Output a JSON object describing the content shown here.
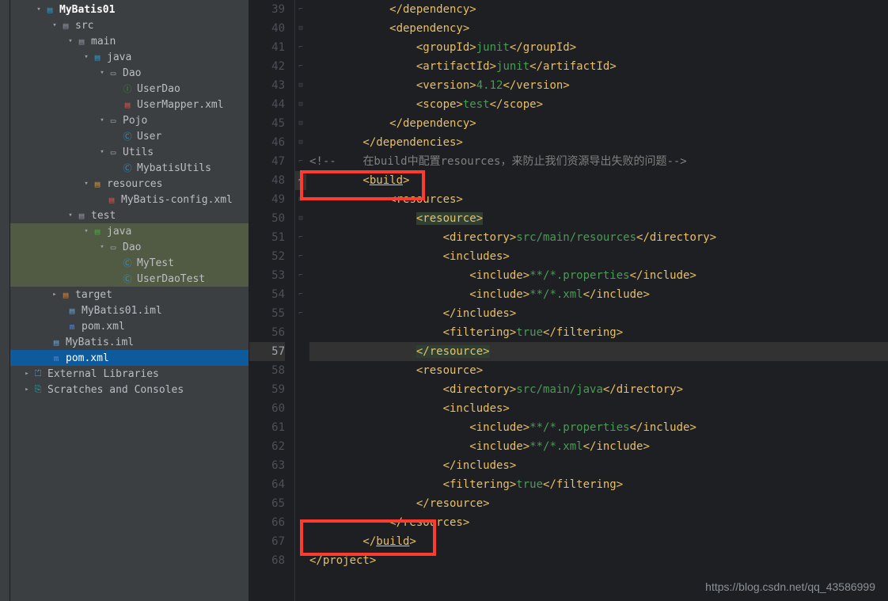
{
  "tree": {
    "MyBatis01": "MyBatis01",
    "src": "src",
    "main": "main",
    "java": "java",
    "Dao": "Dao",
    "UserDao": "UserDao",
    "UserMapper_xml": "UserMapper.xml",
    "Pojo": "Pojo",
    "User": "User",
    "Utils": "Utils",
    "MybatisUtils": "MybatisUtils",
    "resources": "resources",
    "MyBatis_config_xml": "MyBatis-config.xml",
    "test": "test",
    "java2": "java",
    "Dao2": "Dao",
    "MyTest": "MyTest",
    "UserDaoTest": "UserDaoTest",
    "target": "target",
    "MyBatis01_iml": "MyBatis01.iml",
    "pom_xml": "pom.xml",
    "MyBatis_iml": "MyBatis.iml",
    "root_pom_xml": "pom.xml",
    "External_Libraries": "External Libraries",
    "Scratches": "Scratches and Consoles"
  },
  "code": {
    "l39": "            </dependency>",
    "l40": "            <dependency>",
    "l41_a": "                <groupId>",
    "l41_v": "junit",
    "l41_b": "</groupId>",
    "l42_a": "                <artifactId>",
    "l42_v": "junit",
    "l42_b": "</artifactId>",
    "l43_a": "                <version>",
    "l43_v": "4.12",
    "l43_b": "</version>",
    "l44_a": "                <scope>",
    "l44_v": "test",
    "l44_b": "</scope>",
    "l45": "            </dependency>",
    "l46": "        </dependencies>",
    "l47_a": "<!--    ",
    "l47_b": "在build中配置resources，来防止我们资源导出失败的问题",
    "l47_c": "-->",
    "l48": "        <build>",
    "l49": "            <resources>",
    "l50": "                <resource>",
    "l51_a": "                    <directory>",
    "l51_v": "src/main/resources",
    "l51_b": "</directory>",
    "l52": "                    <includes>",
    "l53_a": "                        <include>",
    "l53_v": "**/*.properties",
    "l53_b": "</include>",
    "l54_a": "                        <include>",
    "l54_v": "**/*.xml",
    "l54_b": "</include>",
    "l55": "                    </includes>",
    "l56_a": "                    <filtering>",
    "l56_v": "true",
    "l56_b": "</filtering>",
    "l57": "                </resource>",
    "l58": "                <resource>",
    "l59_a": "                    <directory>",
    "l59_v": "src/main/java",
    "l59_b": "</directory>",
    "l60": "                    <includes>",
    "l61_a": "                        <include>",
    "l61_v": "**/*.properties",
    "l61_b": "</include>",
    "l62_a": "                        <include>",
    "l62_v": "**/*.xml",
    "l62_b": "</include>",
    "l63": "                    </includes>",
    "l64_a": "                    <filtering>",
    "l64_v": "true",
    "l64_b": "</filtering>",
    "l65": "                </resource>",
    "l66": "            </resources>",
    "l67": "        </build>",
    "l68": "</project>"
  },
  "gutter": {
    "start": 39,
    "end": 68
  },
  "watermark": "https://blog.csdn.net/qq_43586999"
}
